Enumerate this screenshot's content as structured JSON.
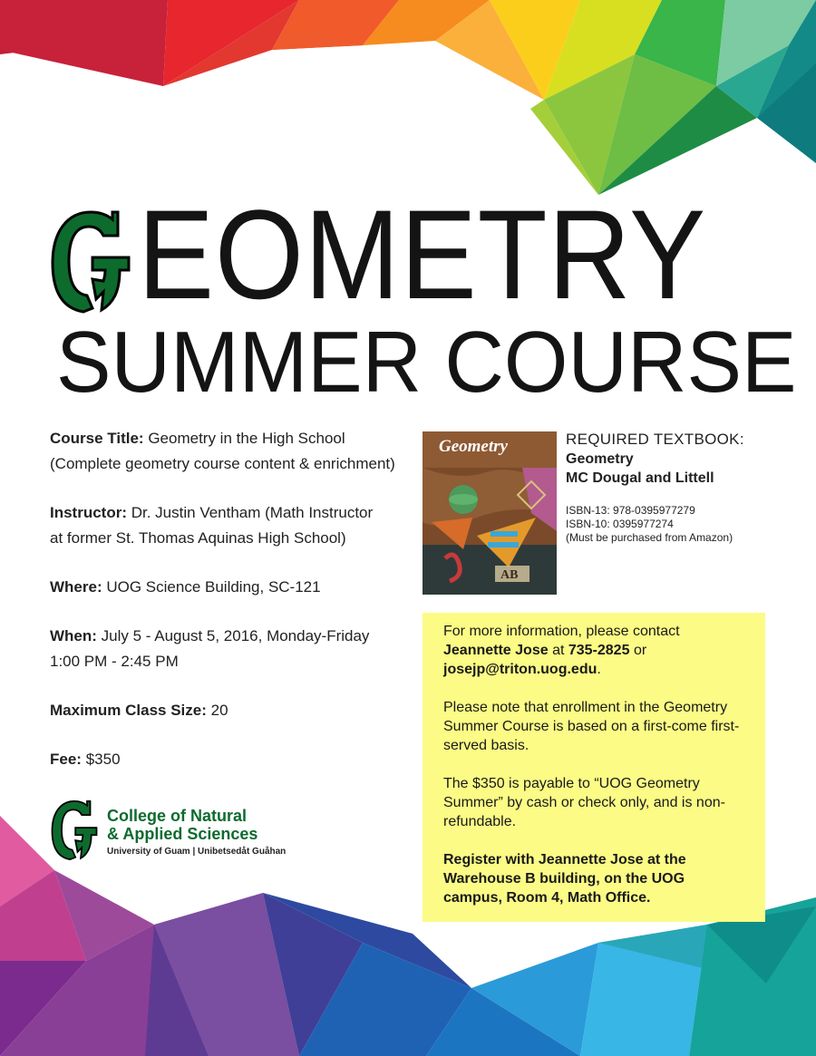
{
  "title": {
    "initial": "G",
    "rest": "EOMETRY",
    "subtitle": "SUMMER COURSE"
  },
  "details": [
    {
      "label": "Course Title:",
      "lines": [
        "Geometry in the High School",
        "(Complete geometry course content & enrichment)"
      ]
    },
    {
      "label": "Instructor:",
      "lines": [
        "Dr. Justin Ventham (Math Instructor",
        "at former St. Thomas Aquinas High School)"
      ]
    },
    {
      "label": "Where:",
      "lines": [
        "UOG Science Building, SC-121"
      ]
    },
    {
      "label": "When:",
      "lines": [
        "July 5 - August 5, 2016, Monday-Friday",
        "1:00 PM - 2:45 PM"
      ]
    },
    {
      "label": "Maximum Class Size:",
      "lines": [
        "20"
      ]
    },
    {
      "label": "Fee:",
      "lines": [
        "$350"
      ]
    }
  ],
  "college": {
    "name_line1": "College of Natural",
    "name_line2": "& Applied Sciences",
    "subtitle": "University of Guam | Unibetsedåt Guåhan"
  },
  "textbook": {
    "cover_title": "Geometry",
    "heading": "REQUIRED TEXTBOOK:",
    "name": "Geometry",
    "publisher": "MC Dougal and Littell",
    "isbn13": "ISBN-13: 978-0395977279",
    "isbn10": "ISBN-10: 0395977274",
    "note": "(Must be purchased from Amazon)"
  },
  "info": {
    "contact_prefix": "For more information, please contact",
    "contact_name": "Jeannette Jose",
    "contact_at": "at",
    "contact_phone": "735-2825",
    "contact_or": "or",
    "contact_email": "josejp@triton.uog.edu",
    "enrollment": "Please note that enrollment in the Geometry Summer Course is based on a first-come first-served basis.",
    "payment": "The $350 is payable to “UOG Geometry Summer” by cash or check only, and is non-refundable.",
    "register": "Register with Jeannette Jose at the Warehouse B building, on the UOG campus, Room 4, Math Office."
  },
  "colors": {
    "brand_green": "#0d6b2e",
    "info_box": "#fbfb86",
    "title_text": "#141414"
  }
}
